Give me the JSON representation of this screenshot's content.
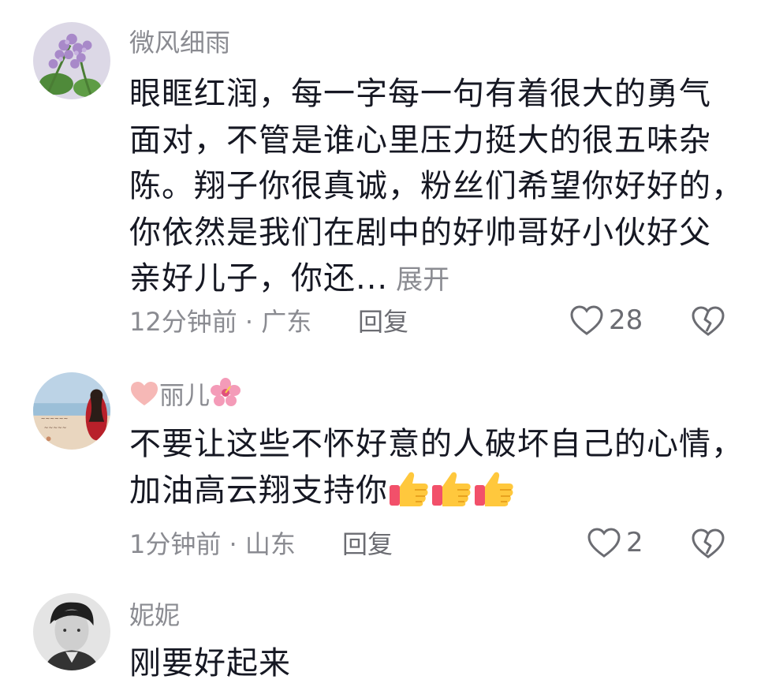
{
  "comments": [
    {
      "username": "微风细雨",
      "lines": [
        "眼眶红润，每一字每一句有着很大的勇气",
        "面对，不管是谁心里压力挺大的很五味杂",
        "陈。翔子你很真诚，粉丝们希望你好好的，",
        "你依然是我们在剧中的好帅哥好小伙好父",
        "亲好儿子，你还..."
      ],
      "expand_label": "展开",
      "meta": "12分钟前 · 广东",
      "reply_label": "回复",
      "like_count": "28",
      "avatar_icon": "lavender-flowers-avatar"
    },
    {
      "username_prefix_icon": "pink-heart-icon",
      "username": "丽儿",
      "username_suffix_icon": "hibiscus-icon",
      "lines": [
        "不要让这些不怀好意的人破坏自己的心情，",
        "加油高云翔支持你"
      ],
      "emoji": [
        "thumbs-up-icon",
        "thumbs-up-icon",
        "thumbs-up-icon"
      ],
      "meta": "1分钟前 · 山东",
      "reply_label": "回复",
      "like_count": "2",
      "avatar_icon": "beach-girl-avatar"
    },
    {
      "username": "妮妮",
      "lines": [
        "刚要好起来"
      ],
      "avatar_icon": "man-portrait-avatar"
    }
  ],
  "colors": {
    "text": "#161823",
    "secondary": "#8a8b91",
    "action": "#6b6c72",
    "thumbs_up": "#ffc83d"
  }
}
